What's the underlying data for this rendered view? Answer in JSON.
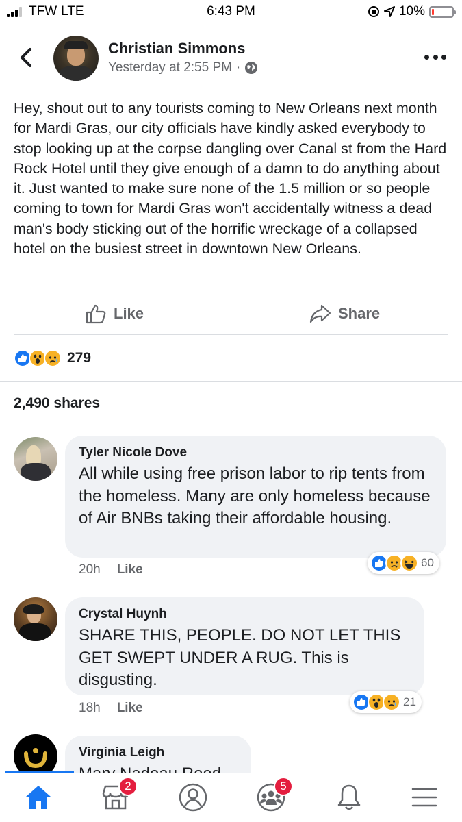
{
  "status_bar": {
    "carrier": "TFW",
    "network": "LTE",
    "time": "6:43 PM",
    "battery": "10%"
  },
  "post": {
    "author": "Christian Simmons",
    "timestamp": "Yesterday at 2:55 PM",
    "separator": "·",
    "privacy_icon": "globe-icon",
    "text": "Hey, shout out to any tourists coming to New Orleans next month for Mardi Gras, our city officials have kindly asked everybody to stop looking up at the corpse dangling over Canal st from the Hard Rock Hotel until they give enough of a damn to do anything about it. Just wanted to make sure none of the 1.5 million or so people coming to town for Mardi Gras won't accidentally witness a dead man's body sticking out of the horrific wreckage of a collapsed hotel on the busiest street in downtown New Orleans.",
    "actions": {
      "like": "Like",
      "share": "Share"
    },
    "reaction_count": "279",
    "shares": "2,490 shares"
  },
  "comments": [
    {
      "name": "Tyler Nicole Dove",
      "text": "All while using free prison labor to rip tents from the homeless. Many are only homeless because of Air BNBs taking their affordable housing.",
      "time": "20h",
      "like": "Like",
      "reaction_count": "60"
    },
    {
      "name": "Crystal Huynh",
      "text": "SHARE THIS, PEOPLE. DO NOT LET THIS GET SWEPT UNDER A RUG. This is disgusting.",
      "time": "18h",
      "like": "Like",
      "reaction_count": "21"
    },
    {
      "name": "Virginia Leigh",
      "text": "Mary Nadeau Reed"
    }
  ],
  "tabbar": {
    "marketplace_badge": "2",
    "groups_badge": "5"
  },
  "colors": {
    "brand_blue": "#1877f2",
    "badge_red": "#e41e3f",
    "bubble_gray": "#f0f2f5",
    "secondary_text": "#65676b"
  }
}
